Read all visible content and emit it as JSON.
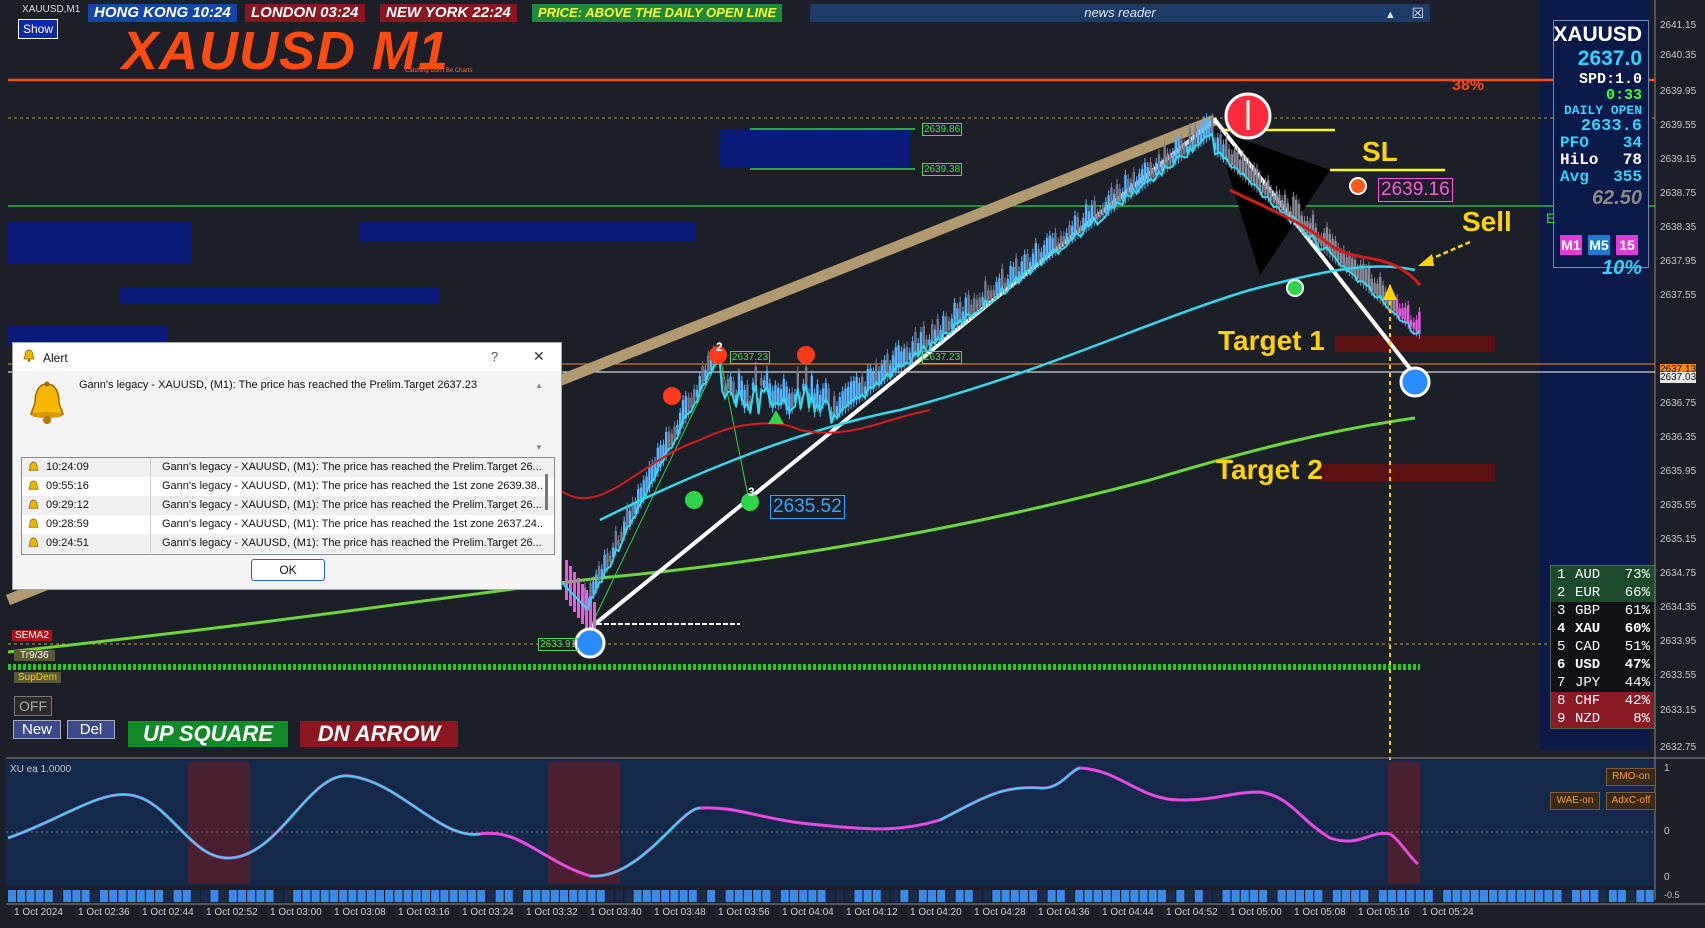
{
  "window": {
    "symbol_tf": "XAUUSD,M1",
    "show_button": "Show"
  },
  "clocks": [
    {
      "label": "HONG KONG 10:24",
      "bg": "#1446a8"
    },
    {
      "label": "LONDON 03:24",
      "bg": "#8a1620"
    },
    {
      "label": "NEW YORK 22:24",
      "bg": "#8a1620"
    },
    {
      "label": "PRICE: ABOVE THE DAILY OPEN LINE",
      "bg": "#1f8a3c",
      "color": "#ffff33"
    }
  ],
  "news": {
    "label": "news reader",
    "btn_up": "▲",
    "btn_close": "☒"
  },
  "title": {
    "main": "XAUUSD M1",
    "sub": "Catching Don't Be Charts"
  },
  "info_panel": {
    "symbol": "XAUUSD",
    "price": "2637.0",
    "spread": "SPD:1.0",
    "timer": "0:33",
    "daily_open_label": "DAILY OPEN",
    "daily_open": "2633.6",
    "pfo_label": "PFO",
    "pfo": "34",
    "hilo_label": "HiLo",
    "hilo": "78",
    "avg_label": "Avg",
    "avg": "355",
    "grey_value": "62.50",
    "tf_buttons": [
      "M1",
      "M5",
      "15"
    ],
    "percent": "10%"
  },
  "currency_strength": [
    {
      "rank": "1",
      "cur": "AUD",
      "pct": "73%",
      "bg": "#1d4a2a"
    },
    {
      "rank": "2",
      "cur": "EUR",
      "pct": "66%",
      "bg": "#1d4a2a"
    },
    {
      "rank": "3",
      "cur": "GBP",
      "pct": "61%",
      "bg": "#101218"
    },
    {
      "rank": "4",
      "cur": "XAU",
      "pct": "60%",
      "bg": "#101218",
      "bold": true
    },
    {
      "rank": "5",
      "cur": "CAD",
      "pct": "51%",
      "bg": "#101218"
    },
    {
      "rank": "6",
      "cur": "USD",
      "pct": "47%",
      "bg": "#101218",
      "bold": true
    },
    {
      "rank": "7",
      "cur": "JPY",
      "pct": "44%",
      "bg": "#101218"
    },
    {
      "rank": "8",
      "cur": "CHF",
      "pct": "42%",
      "bg": "#8a1a24"
    },
    {
      "rank": "9",
      "cur": "NZD",
      "pct": "8%",
      "bg": "#8a1a24"
    }
  ],
  "chart_labels": {
    "pct38": "38%",
    "sl": "SL",
    "sl_price": "2639.16",
    "sell": "Sell",
    "target1": "Target 1",
    "target2": "Target 2",
    "zone_top": "2639.86",
    "zone_bot": "2639.38",
    "prelim": "2637.23",
    "prelim2": "2637.23",
    "low_price": "2635.52",
    "bottom_price": "2633.91",
    "wave2": "2",
    "wave3": "3",
    "green_e": "E"
  },
  "price_axis": [
    "2641.15",
    "2640.35",
    "2639.95",
    "2639.55",
    "2639.15",
    "2638.75",
    "2638.35",
    "2637.95",
    "2637.55",
    "2637.13",
    "2637.03",
    "2636.75",
    "2636.35",
    "2635.95",
    "2635.55",
    "2635.15",
    "2634.75",
    "2634.35",
    "2633.95",
    "2633.55",
    "2633.15",
    "2632.75"
  ],
  "time_axis": [
    "1 Oct 2024",
    "1 Oct 02:36",
    "1 Oct 02:44",
    "1 Oct 02:52",
    "1 Oct 03:00",
    "1 Oct 03:08",
    "1 Oct 03:16",
    "1 Oct 03:24",
    "1 Oct 03:32",
    "1 Oct 03:40",
    "1 Oct 03:48",
    "1 Oct 03:56",
    "1 Oct 04:04",
    "1 Oct 04:12",
    "1 Oct 04:20",
    "1 Oct 04:28",
    "1 Oct 04:36",
    "1 Oct 04:44",
    "1 Oct 04:52",
    "1 Oct 05:00",
    "1 Oct 05:08",
    "1 Oct 05:16",
    "1 Oct 05:24"
  ],
  "left_tags": {
    "sema2": "SEMA2",
    "tr936": "Tr9/36",
    "supdem": "SupDem",
    "off": "OFF",
    "new": "New",
    "del": "Del"
  },
  "bottom_buttons": {
    "up": "UP SQUARE",
    "dn": "DN ARROW"
  },
  "sub_window": {
    "label": "XU ea 1.0000",
    "rmo": "RMO-on",
    "wae": "WAE-on",
    "adxc": "AdxC-off",
    "axis_top": "1",
    "axis_mid": "0",
    "axis_bot": "0",
    "axis_neg": "-0.5"
  },
  "alert": {
    "title": "Alert",
    "help": "?",
    "close": "✕",
    "message": "Gann's legacy - XAUUSD, (M1): The price has reached the Prelim.Target 2637.23",
    "rows": [
      {
        "time": "10:24:09",
        "msg": "Gann's legacy - XAUUSD, (M1): The price has reached the Prelim.Target 26..."
      },
      {
        "time": "09:55:16",
        "msg": "Gann's legacy - XAUUSD, (M1): The price has reached the 1st zone 2639.38..."
      },
      {
        "time": "09:29:12",
        "msg": "Gann's legacy - XAUUSD, (M1): The price has reached the Prelim.Target 26..."
      },
      {
        "time": "09:28:59",
        "msg": "Gann's legacy - XAUUSD, (M1): The price has reached the 1st zone 2637.24..."
      },
      {
        "time": "09:24:51",
        "msg": "Gann's legacy - XAUUSD, (M1): The price has reached the Prelim.Target 26..."
      }
    ],
    "ok": "OK"
  },
  "colors": {
    "bg": "#1c1f28",
    "panel_bg": "#0a1a48",
    "orange_line": "#ff4a12",
    "green_ma": "#6dd63a",
    "cyan_ma": "#35d8e8"
  }
}
